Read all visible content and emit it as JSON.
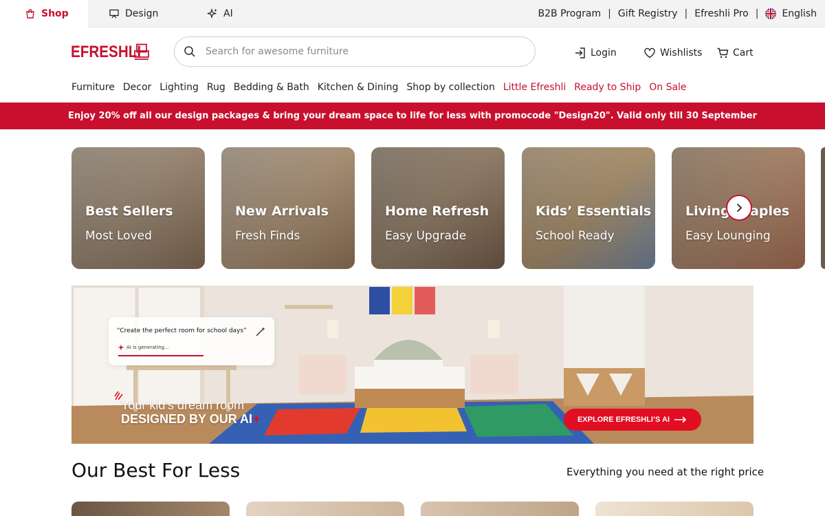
{
  "topbar": {
    "modes": [
      {
        "label": "Shop",
        "icon": "shopping-bag-icon",
        "active": true
      },
      {
        "label": "Design",
        "icon": "easel-icon",
        "active": false
      },
      {
        "label": "AI",
        "icon": "sparkles-icon",
        "active": false
      }
    ],
    "links": [
      "B2B Program",
      "Gift Registry",
      "Efreshli Pro"
    ],
    "separator": "|",
    "language": "English",
    "language_icon": "uk-flag-icon"
  },
  "header": {
    "logo": "EFRESHLI",
    "search_placeholder": "Search for awesome furniture",
    "login": "Login",
    "wishlists": "Wishlists",
    "cart": "Cart"
  },
  "nav": {
    "items": [
      "Furniture",
      "Decor",
      "Lighting",
      "Rug",
      "Bedding & Bath",
      "Kitchen & Dining",
      "Shop by collection"
    ],
    "highlight_items": [
      "Little Efreshli",
      "Ready to Ship",
      "On Sale"
    ]
  },
  "promo": {
    "text": "Enjoy 20% off all our design packages & bring your dream space to life for less with promocode \"Design20\". Valid only till 30 September"
  },
  "collections": [
    {
      "title": "Best Sellers",
      "subtitle": "Most Loved"
    },
    {
      "title": "New Arrivals",
      "subtitle": "Fresh Finds"
    },
    {
      "title": "Home Refresh",
      "subtitle": "Easy Upgrade"
    },
    {
      "title": "Kids’ Essentials",
      "subtitle": "School Ready"
    },
    {
      "title": "Living Staples",
      "subtitle": "Easy Lounging"
    }
  ],
  "hero": {
    "prompt": "“Create the perfect room for school days”",
    "status": "AI is generating...",
    "line1": "Your kid’s dream room",
    "line2": "DESIGNED BY OUR AI",
    "cta": "EXPLORE EFRESHLI’S AI"
  },
  "section": {
    "title": "Our Best For Less",
    "subtitle": "Everything you need at the right price"
  },
  "colors": {
    "brand_red": "#c8102e",
    "promo_bg": "#c8102e",
    "cta_red": "#e10d22",
    "topbar_bg": "#f3f3f3"
  }
}
